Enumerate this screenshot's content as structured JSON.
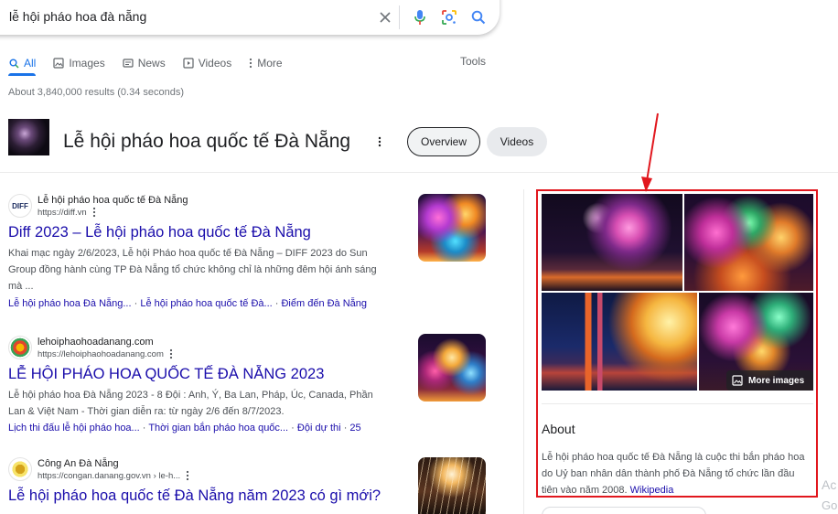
{
  "search": {
    "query": "lễ hội pháo hoa đà nẵng"
  },
  "tabs": [
    {
      "label": "All",
      "icon": "search-icon",
      "active": true
    },
    {
      "label": "Images",
      "icon": "image-icon"
    },
    {
      "label": "News",
      "icon": "news-icon"
    },
    {
      "label": "Videos",
      "icon": "play-icon"
    },
    {
      "label": "More",
      "icon": "kebab-icon"
    }
  ],
  "tools_label": "Tools",
  "result_stats": "About 3,840,000 results (0.34 seconds)",
  "entity": {
    "title": "Lễ hội pháo hoa quốc tế Đà Nẵng",
    "chips": [
      "Overview",
      "Videos"
    ]
  },
  "results": [
    {
      "favicon_text": "DIFF",
      "site_name": "Lễ hội pháo hoa quốc tế Đà Nẵng",
      "url": "https://diff.vn",
      "title": "Diff 2023 – Lễ hội pháo hoa quốc tế Đà Nẵng",
      "snippet": "Khai mạc ngày 2/6/2023, Lễ hội Pháo hoa quốc tế Đà Nẵng – DIFF 2023 do Sun Group đồng hành cùng TP Đà Nẵng tổ chức không chỉ là những đêm hội ánh sáng mà ...",
      "links": [
        "Lễ hội pháo hoa Đà Nẵng...",
        "Lễ hội pháo hoa quốc tế Đà...",
        "Điểm đến Đà Nẵng"
      ]
    },
    {
      "favicon_text": "",
      "site_name": "lehoiphaohoadanang.com",
      "url": "https://lehoiphaohoadanang.com",
      "title": "LỄ HỘI PHÁO HOA QUỐC TẾ ĐÀ NẴNG 2023",
      "snippet": "Lễ hội pháo hoa Đà Nẵng 2023 - 8 Đội : Anh, Ý, Ba Lan, Pháp, Úc, Canada, Phần Lan & Việt Nam - Thời gian diễn ra: từ ngày 2/6 đến 8/7/2023.",
      "links": [
        "Lịch thi đấu lễ hội pháo hoa...",
        "Thời gian bắn pháo hoa quốc...",
        "Đội dự thi",
        "25"
      ]
    },
    {
      "favicon_text": "",
      "site_name": "Công An Đà Nẵng",
      "url": "https://congan.danang.gov.vn › le-h...",
      "title": "Lễ hội pháo hoa quốc tế Đà Nẵng năm 2023 có gì mới?"
    }
  ],
  "knowledge_panel": {
    "more_images_label": "More images",
    "about_heading": "About",
    "description": "Lễ hội pháo hoa quốc tế Đà Nẵng là cuộc thi bắn pháo hoa do Uỷ ban nhân dân thành phố Đà Nẵng tổ chức lần đầu tiên vào năm 2008.",
    "source_link": "Wikipedia"
  },
  "edge_text": {
    "line1": "Ac",
    "line2": "Go"
  },
  "colors": {
    "link": "#1a0dab",
    "accent": "#1a73e8",
    "highlight_box": "#e1171e"
  }
}
